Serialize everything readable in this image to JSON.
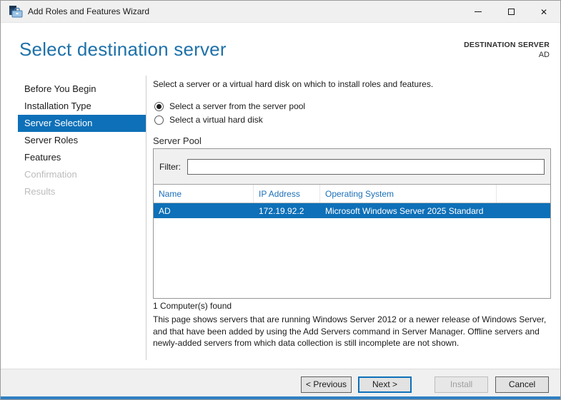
{
  "window": {
    "title": "Add Roles and Features Wizard",
    "icon": "server-manager-wizard-icon",
    "close_glyph": "✕"
  },
  "header": {
    "title": "Select destination server",
    "destination_label": "DESTINATION SERVER",
    "destination_value": "AD"
  },
  "sidebar": {
    "items": [
      {
        "label": "Before You Begin",
        "state": "enabled"
      },
      {
        "label": "Installation Type",
        "state": "enabled"
      },
      {
        "label": "Server Selection",
        "state": "selected"
      },
      {
        "label": "Server Roles",
        "state": "enabled"
      },
      {
        "label": "Features",
        "state": "enabled"
      },
      {
        "label": "Confirmation",
        "state": "disabled"
      },
      {
        "label": "Results",
        "state": "disabled"
      }
    ]
  },
  "content": {
    "intro": "Select a server or a virtual hard disk on which to install roles and features.",
    "radios": [
      {
        "label": "Select a server from the server pool",
        "selected": true
      },
      {
        "label": "Select a virtual hard disk",
        "selected": false
      }
    ],
    "server_pool": {
      "title": "Server Pool",
      "filter_label": "Filter:",
      "filter_value": "",
      "table": {
        "columns": [
          "Name",
          "IP Address",
          "Operating System"
        ],
        "rows": [
          {
            "name": "AD",
            "ip": "172.19.92.2",
            "os": "Microsoft Windows Server 2025 Standard",
            "selected": true
          }
        ]
      },
      "found_text": "1 Computer(s) found"
    },
    "description": "This page shows servers that are running Windows Server 2012 or a newer release of Windows Server, and that have been added by using the Add Servers command in Server Manager. Offline servers and newly-added servers from which data collection is still incomplete are not shown."
  },
  "footer": {
    "buttons": [
      {
        "label": "< Previous",
        "state": "enabled"
      },
      {
        "label": "Next >",
        "state": "default"
      },
      {
        "label": "Install",
        "state": "disabled"
      },
      {
        "label": "Cancel",
        "state": "enabled"
      }
    ]
  },
  "colors": {
    "accent": "#0e70b8",
    "heading": "#1e71a9",
    "table_header": "#1b6fb8",
    "bottom_bar": "#2f80c3",
    "titlebar_bg": "#f0f0f0",
    "footer_bg": "#f0f0f0",
    "disabled_text": "#bcbcbc"
  }
}
